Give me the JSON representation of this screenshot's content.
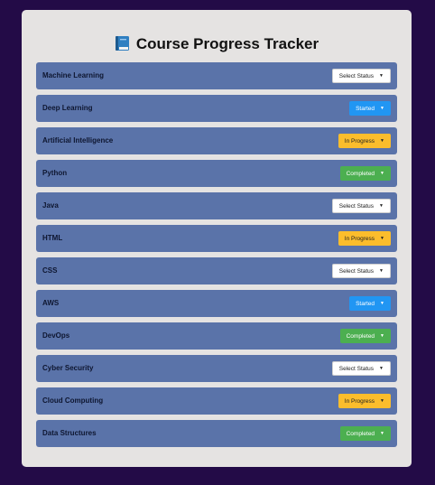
{
  "header": {
    "title": "Course Progress Tracker",
    "icon": "book-icon"
  },
  "colors": {
    "page_background": "#230b47",
    "card_background": "#e5e3e2",
    "row_background": "#5a73a9",
    "started": "#2196f3",
    "in_progress": "#fbbd2c",
    "completed": "#4caf50",
    "select": "#ffffff"
  },
  "courses": [
    {
      "name": "Machine Learning",
      "status": "Select Status",
      "kind": "none"
    },
    {
      "name": "Deep Learning",
      "status": "Started",
      "kind": "started"
    },
    {
      "name": "Artificial Intelligence",
      "status": "In Progress",
      "kind": "progress"
    },
    {
      "name": "Python",
      "status": "Completed",
      "kind": "completed"
    },
    {
      "name": "Java",
      "status": "Select Status",
      "kind": "none"
    },
    {
      "name": "HTML",
      "status": "In Progress",
      "kind": "progress"
    },
    {
      "name": "CSS",
      "status": "Select Status",
      "kind": "none"
    },
    {
      "name": "AWS",
      "status": "Started",
      "kind": "started"
    },
    {
      "name": "DevOps",
      "status": "Completed",
      "kind": "completed"
    },
    {
      "name": "Cyber Security",
      "status": "Select Status",
      "kind": "none"
    },
    {
      "name": "Cloud Computing",
      "status": "In Progress",
      "kind": "progress"
    },
    {
      "name": "Data Structures",
      "status": "Completed",
      "kind": "completed"
    }
  ]
}
